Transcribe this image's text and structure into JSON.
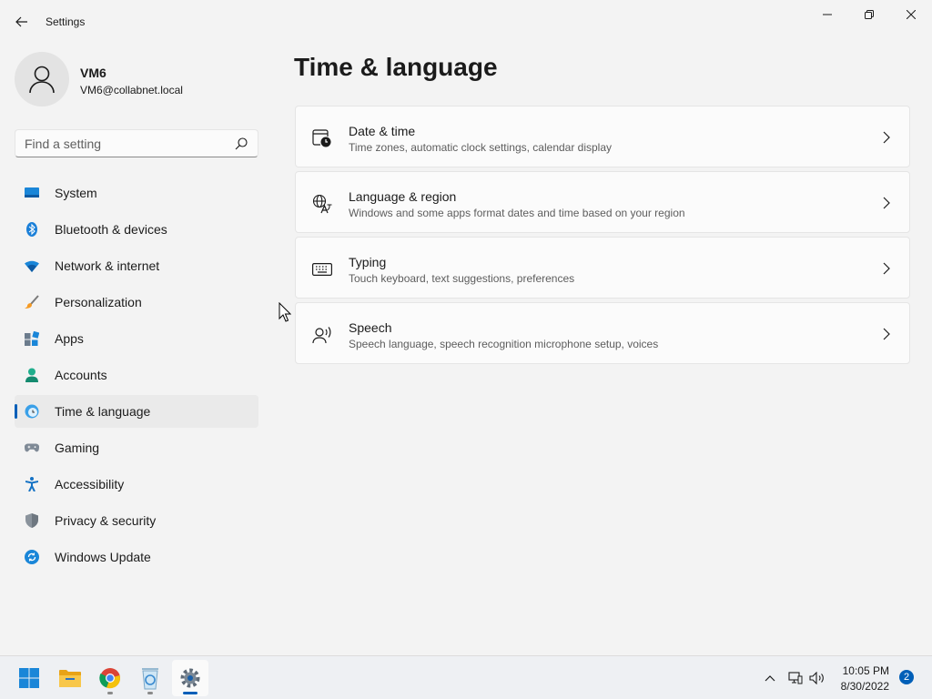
{
  "window": {
    "title": "Settings"
  },
  "user": {
    "name": "VM6",
    "email": "VM6@collabnet.local"
  },
  "search": {
    "placeholder": "Find a setting"
  },
  "sidebar": {
    "items": [
      {
        "label": "System",
        "icon": "system-icon"
      },
      {
        "label": "Bluetooth & devices",
        "icon": "bluetooth-icon"
      },
      {
        "label": "Network & internet",
        "icon": "wifi-icon"
      },
      {
        "label": "Personalization",
        "icon": "brush-icon"
      },
      {
        "label": "Apps",
        "icon": "apps-icon"
      },
      {
        "label": "Accounts",
        "icon": "accounts-icon"
      },
      {
        "label": "Time & language",
        "icon": "globe-clock-icon",
        "active": true
      },
      {
        "label": "Gaming",
        "icon": "gamepad-icon"
      },
      {
        "label": "Accessibility",
        "icon": "accessibility-icon"
      },
      {
        "label": "Privacy & security",
        "icon": "shield-icon"
      },
      {
        "label": "Windows Update",
        "icon": "update-icon"
      }
    ]
  },
  "main": {
    "title": "Time & language",
    "cards": [
      {
        "title": "Date & time",
        "description": "Time zones, automatic clock settings, calendar display",
        "icon": "calendar-clock-icon"
      },
      {
        "title": "Language & region",
        "description": "Windows and some apps format dates and time based on your region",
        "icon": "language-icon"
      },
      {
        "title": "Typing",
        "description": "Touch keyboard, text suggestions, preferences",
        "icon": "keyboard-icon"
      },
      {
        "title": "Speech",
        "description": "Speech language, speech recognition microphone setup, voices",
        "icon": "speech-icon"
      }
    ]
  },
  "taskbar": {
    "apps": [
      "start-icon",
      "file-explorer-icon",
      "chrome-icon",
      "recycle-bin-icon",
      "settings-icon"
    ],
    "clock": {
      "time": "10:05 PM",
      "date": "8/30/2022"
    },
    "notification_count": "2"
  },
  "colors": {
    "accent": "#005fb8",
    "background": "#f3f3f3",
    "card": "#fbfbfb"
  }
}
